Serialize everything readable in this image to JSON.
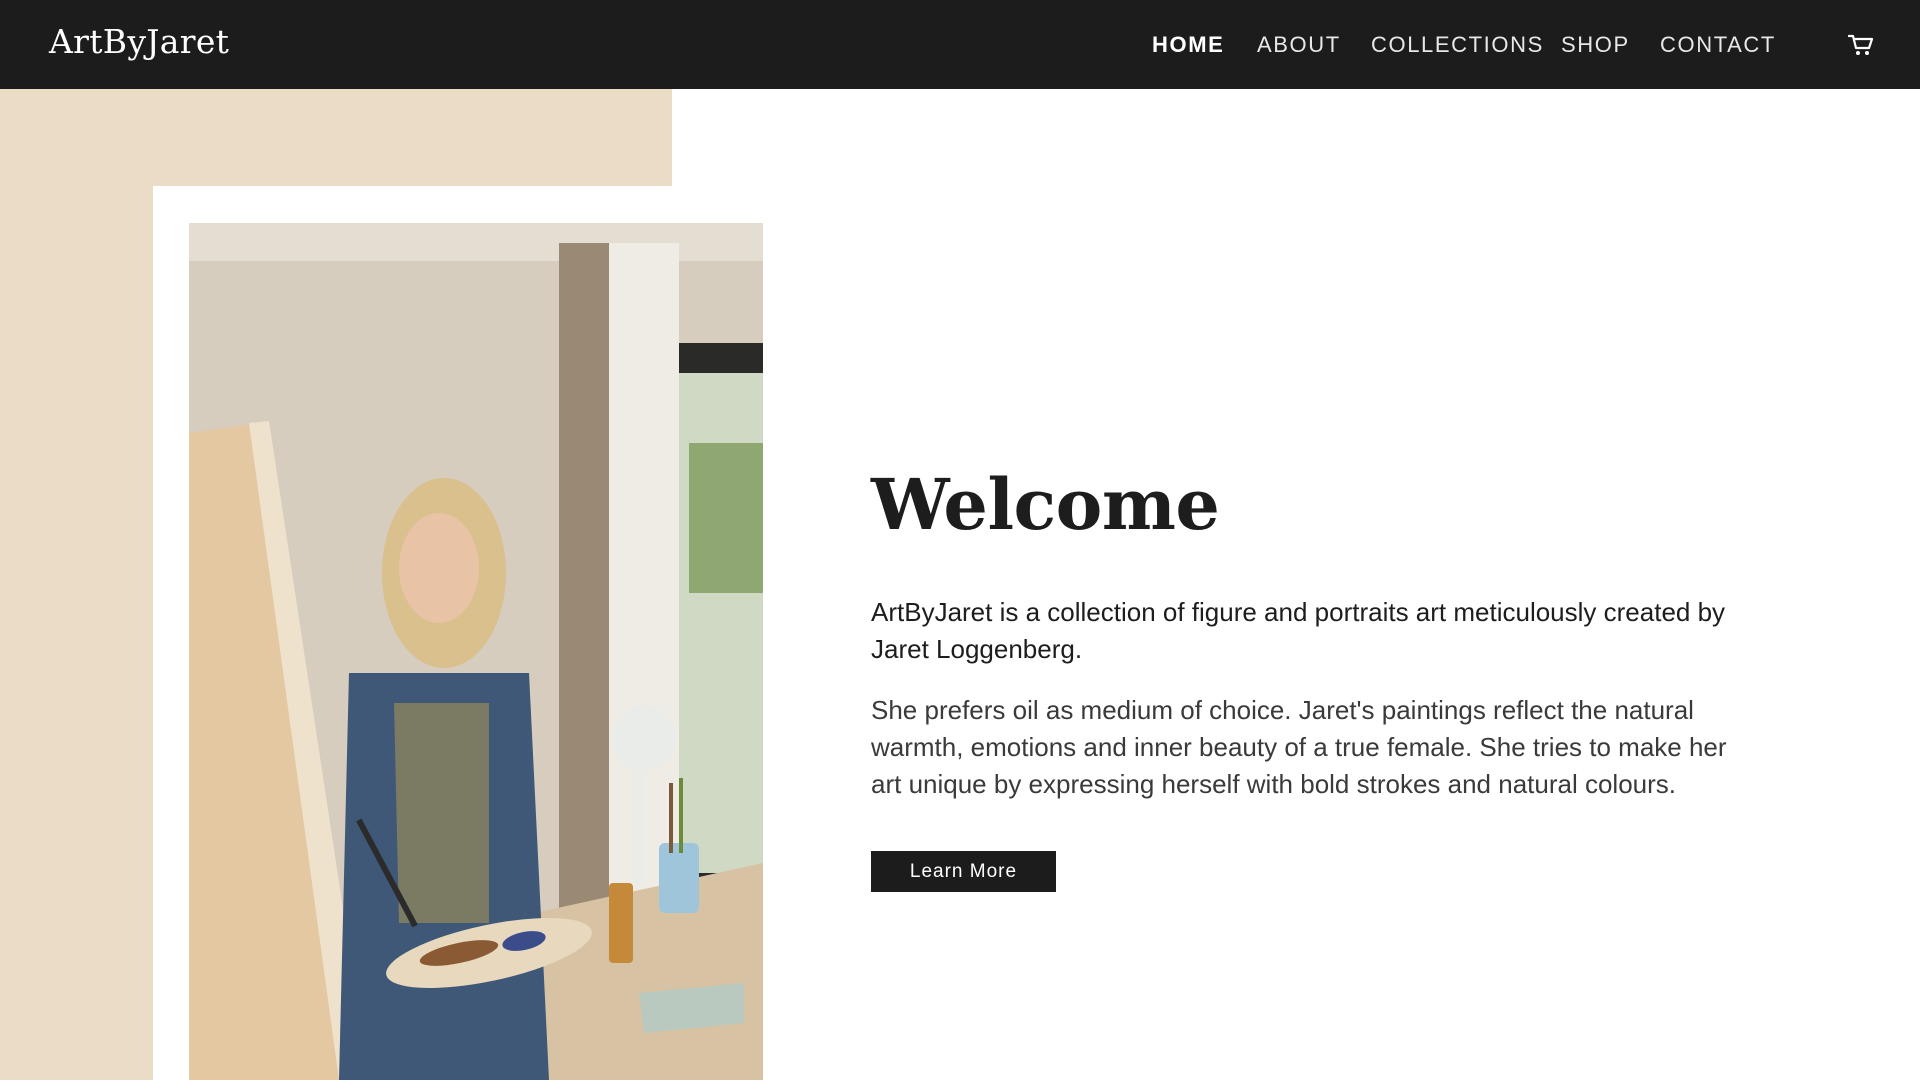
{
  "header": {
    "logo": "ArtByJaret",
    "nav": [
      {
        "label": "HOME",
        "active": true
      },
      {
        "label": "ABOUT",
        "active": false
      },
      {
        "label": "COLLECTIONS",
        "active": false
      },
      {
        "label": "SHOP",
        "active": false
      },
      {
        "label": "CONTACT",
        "active": false
      }
    ],
    "cart_icon": "cart-icon"
  },
  "hero": {
    "title": "Welcome",
    "lead": "ArtByJaret is a collection of figure and portraits art meticulously created by Jaret Loggenberg.",
    "body": "She prefers oil as medium of choice. Jaret's paintings reflect the natural warmth, emotions and inner beauty of a true female. She tries to make her art unique by expressing herself with bold strokes and natural colours.",
    "cta_label": "Learn More",
    "image_subject": "woman-painting-photo"
  },
  "colors": {
    "header_bg": "#1c1c1c",
    "beige": "#eadcc5",
    "text": "#1d1d1d",
    "button_bg": "#1c1c1c"
  }
}
